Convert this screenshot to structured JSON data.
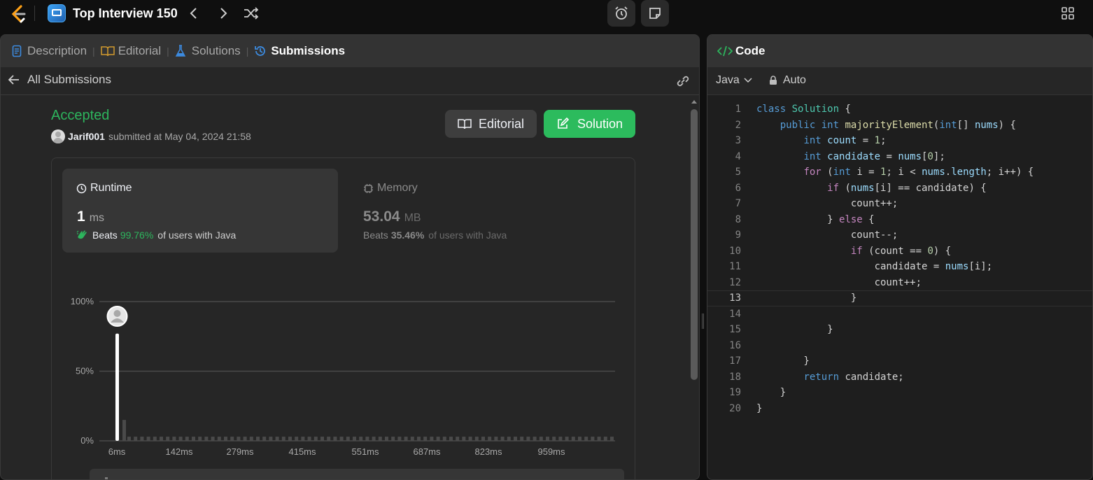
{
  "topbar": {
    "title": "Top Interview 150"
  },
  "left_tabs": [
    {
      "label": "Description"
    },
    {
      "label": "Editorial"
    },
    {
      "label": "Solutions"
    },
    {
      "label": "Submissions"
    }
  ],
  "back": {
    "label": "All Submissions"
  },
  "submission": {
    "status": "Accepted",
    "user": "Jarif001",
    "submitted_text": "submitted at May 04, 2024 21:58"
  },
  "buttons": {
    "editorial": "Editorial",
    "solution": "Solution"
  },
  "runtime": {
    "title": "Runtime",
    "value": "1",
    "unit": "ms",
    "beats_prefix": "Beats",
    "beats_pct": "99.76%",
    "beats_suffix": "of users with Java"
  },
  "memory": {
    "title": "Memory",
    "value": "53.04",
    "unit": "MB",
    "beats_prefix": "Beats",
    "beats_pct": "35.46%",
    "beats_suffix": "of users with Java"
  },
  "chart_data": {
    "type": "bar",
    "y_ticks": [
      "100%",
      "50%",
      "0%"
    ],
    "x_ticks": [
      "6ms",
      "142ms",
      "279ms",
      "415ms",
      "551ms",
      "687ms",
      "823ms",
      "959ms"
    ],
    "ylim": [
      0,
      100
    ],
    "highlight_value_pct": 77,
    "second_value_pct": 15,
    "flat_value_pct": 3,
    "flat_bar_count": 76,
    "mini_x_ticks": [
      "6ms",
      "142ms",
      "279ms",
      "415ms",
      "551ms",
      "687ms",
      "823ms",
      "959ms"
    ]
  },
  "code_panel": {
    "title": "Code",
    "language": "Java",
    "mode": "Auto"
  },
  "code": [
    "class Solution {",
    "    public int majorityElement(int[] nums) {",
    "        int count = 1;",
    "        int candidate = nums[0];",
    "        for (int i = 1; i < nums.length; i++) {",
    "            if (nums[i] == candidate) {",
    "                count++;",
    "            } else {",
    "                count--;",
    "                if (count == 0) {",
    "                    candidate = nums[i];",
    "                    count++;",
    "                }",
    "",
    "            }",
    "",
    "        }",
    "        return candidate;",
    "    }",
    "}"
  ],
  "colors": {
    "accent_green": "#2cbb5d",
    "accepted": "#2db55d",
    "brand_orange": "#ffa116",
    "bg": "#0f0f0f",
    "panel": "#262626"
  }
}
